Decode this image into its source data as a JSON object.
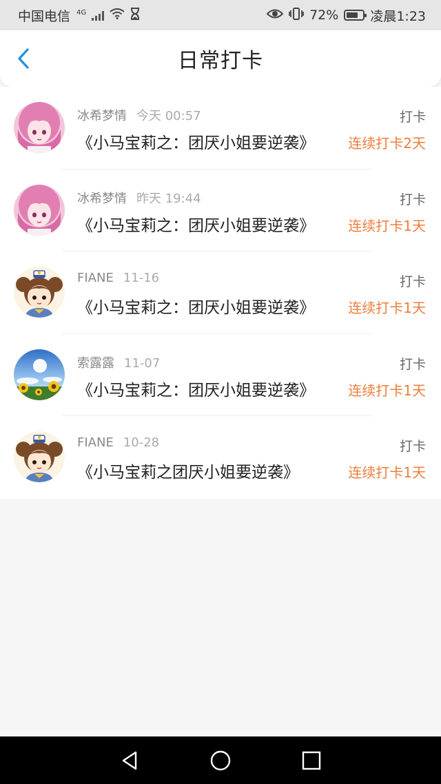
{
  "status_bar": {
    "carrier": "中国电信",
    "network": "4G",
    "battery_percent": "72%",
    "battery_level": 0.72,
    "time": "凌晨1:23"
  },
  "header": {
    "title": "日常打卡",
    "back_icon": "chevron-left-icon"
  },
  "entries": [
    {
      "user": "冰希梦情",
      "time": "今天 00:57",
      "book": "《小马宝莉之：团厌小姐要逆袭》",
      "action": "打卡",
      "streak": "连续打卡2天",
      "avatar": "anime-pink-girl"
    },
    {
      "user": "冰希梦情",
      "time": "昨天 19:44",
      "book": "《小马宝莉之：团厌小姐要逆袭》",
      "action": "打卡",
      "streak": "连续打卡1天",
      "avatar": "anime-pink-girl"
    },
    {
      "user": "FIANE",
      "time": "11-16",
      "book": "《小马宝莉之：团厌小姐要逆袭》",
      "action": "打卡",
      "streak": "连续打卡1天",
      "avatar": "cartoon-girl-hat"
    },
    {
      "user": "索露露",
      "time": "11-07",
      "book": "《小马宝莉之：团厌小姐要逆袭》",
      "action": "打卡",
      "streak": "连续打卡1天",
      "avatar": "sunflower-sky"
    },
    {
      "user": "FIANE",
      "time": "10-28",
      "book": "《小马宝莉之团厌小姐要逆袭》",
      "action": "打卡",
      "streak": "连续打卡1天",
      "avatar": "cartoon-girl-hat"
    }
  ],
  "colors": {
    "accent_blue": "#1e90e6",
    "streak_orange": "#f07c3a",
    "background": "#f7f6f7"
  },
  "nav_bar": {
    "back_icon": "triangle-back-icon",
    "home_icon": "circle-home-icon",
    "recents_icon": "square-recents-icon"
  }
}
